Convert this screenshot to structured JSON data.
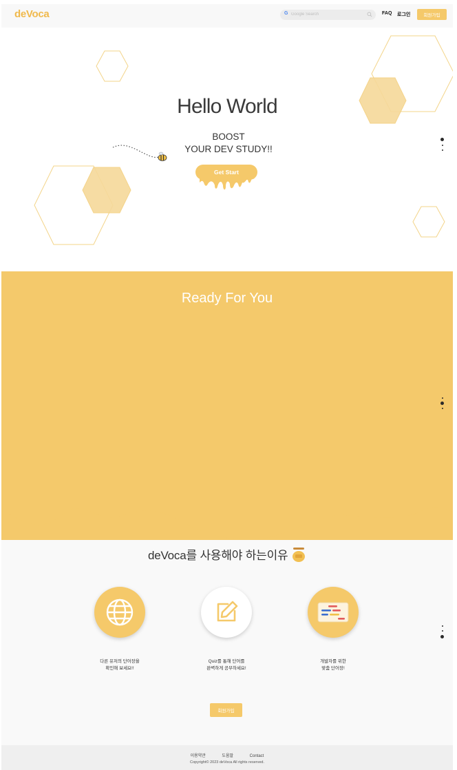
{
  "header": {
    "logo": "deVoca",
    "search_placeholder": "Google Search",
    "faq": "FAQ",
    "login": "로그인",
    "signup": "회원가입"
  },
  "hero": {
    "title": "Hello World",
    "subtitle_line1": "BOOST",
    "subtitle_line2": "YOUR DEV STUDY!!",
    "cta": "Get Start"
  },
  "ready": {
    "title": "Ready For You"
  },
  "why": {
    "title": "deVoca를 사용해야 하는이유",
    "features": [
      {
        "icon": "globe-icon",
        "text": "다른 유저의 단어장을\n확인해 보세요!!"
      },
      {
        "icon": "edit-icon",
        "text": "Quiz를 통해 단어를\n완벽하게 공부하세요!"
      },
      {
        "icon": "code-list-icon",
        "text": "개발자를 위한\n맞춤 단어장!"
      }
    ],
    "signup": "회원가입"
  },
  "footer": {
    "links": [
      "이용약관",
      "도움말",
      "Contact"
    ],
    "copyright": "Copyright© 2023 deVoca All rights reserved."
  },
  "colors": {
    "accent": "#f4c96b",
    "text": "#333333",
    "footer_bg": "#efefef"
  }
}
